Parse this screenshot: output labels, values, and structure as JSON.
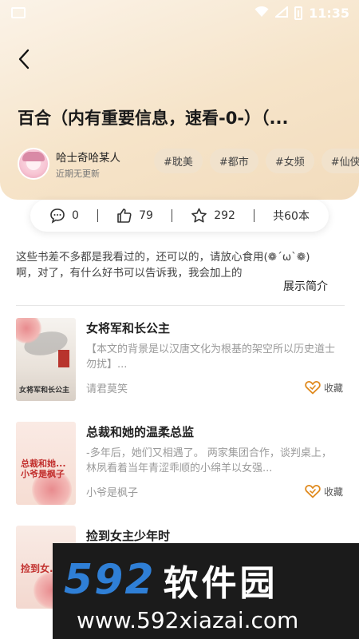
{
  "status_bar": {
    "time": "11:35"
  },
  "header": {
    "title": "百合（内有重要信息，速看-0-）（...",
    "author_name": "哈士奇哈某人",
    "update_status": "近期无更新",
    "tags": [
      "#耽美",
      "#都市",
      "#女频",
      "#仙侠"
    ]
  },
  "stats": {
    "comments": "0",
    "likes": "79",
    "stars": "292",
    "total": "共60本"
  },
  "description": {
    "lines": [
      "这些书差不多都是我看过的，还可以的，请放心食用(❁´ω`❁)",
      "啊，对了，有什么好书可以告诉我，我会加上的"
    ],
    "expand_label": "展示简介"
  },
  "books": [
    {
      "title": "女将军和长公主",
      "desc": "【本文的背景是以汉唐文化为根基的架空所以历史道士勿扰】...",
      "author": "请君莫笑",
      "fav_label": "收藏",
      "cover_text": "女将军和长公主"
    },
    {
      "title": "总裁和她的温柔总监",
      "desc": "-多年后，她们又相遇了。 两家集团合作，谈判桌上，林夙看着当年青涩乖顺的小绵羊以女强...",
      "author": "小爷是枫子",
      "fav_label": "收藏",
      "cover_text": "总裁和她... 小爷是枫子"
    },
    {
      "title": "捡到女主少年时",
      "desc": "",
      "author": "",
      "fav_label": "",
      "cover_text": "捡到女..."
    }
  ],
  "watermark": {
    "number": "592",
    "brand": "软件园",
    "url": "www.592xiazai.com"
  },
  "colors": {
    "header_gradient_start": "#fbf3e8",
    "header_gradient_end": "#f2dcbd",
    "tag_bg": "#f1e2cc",
    "fav_icon": "#e08a1e",
    "watermark_blue": "#2f7fd6"
  }
}
